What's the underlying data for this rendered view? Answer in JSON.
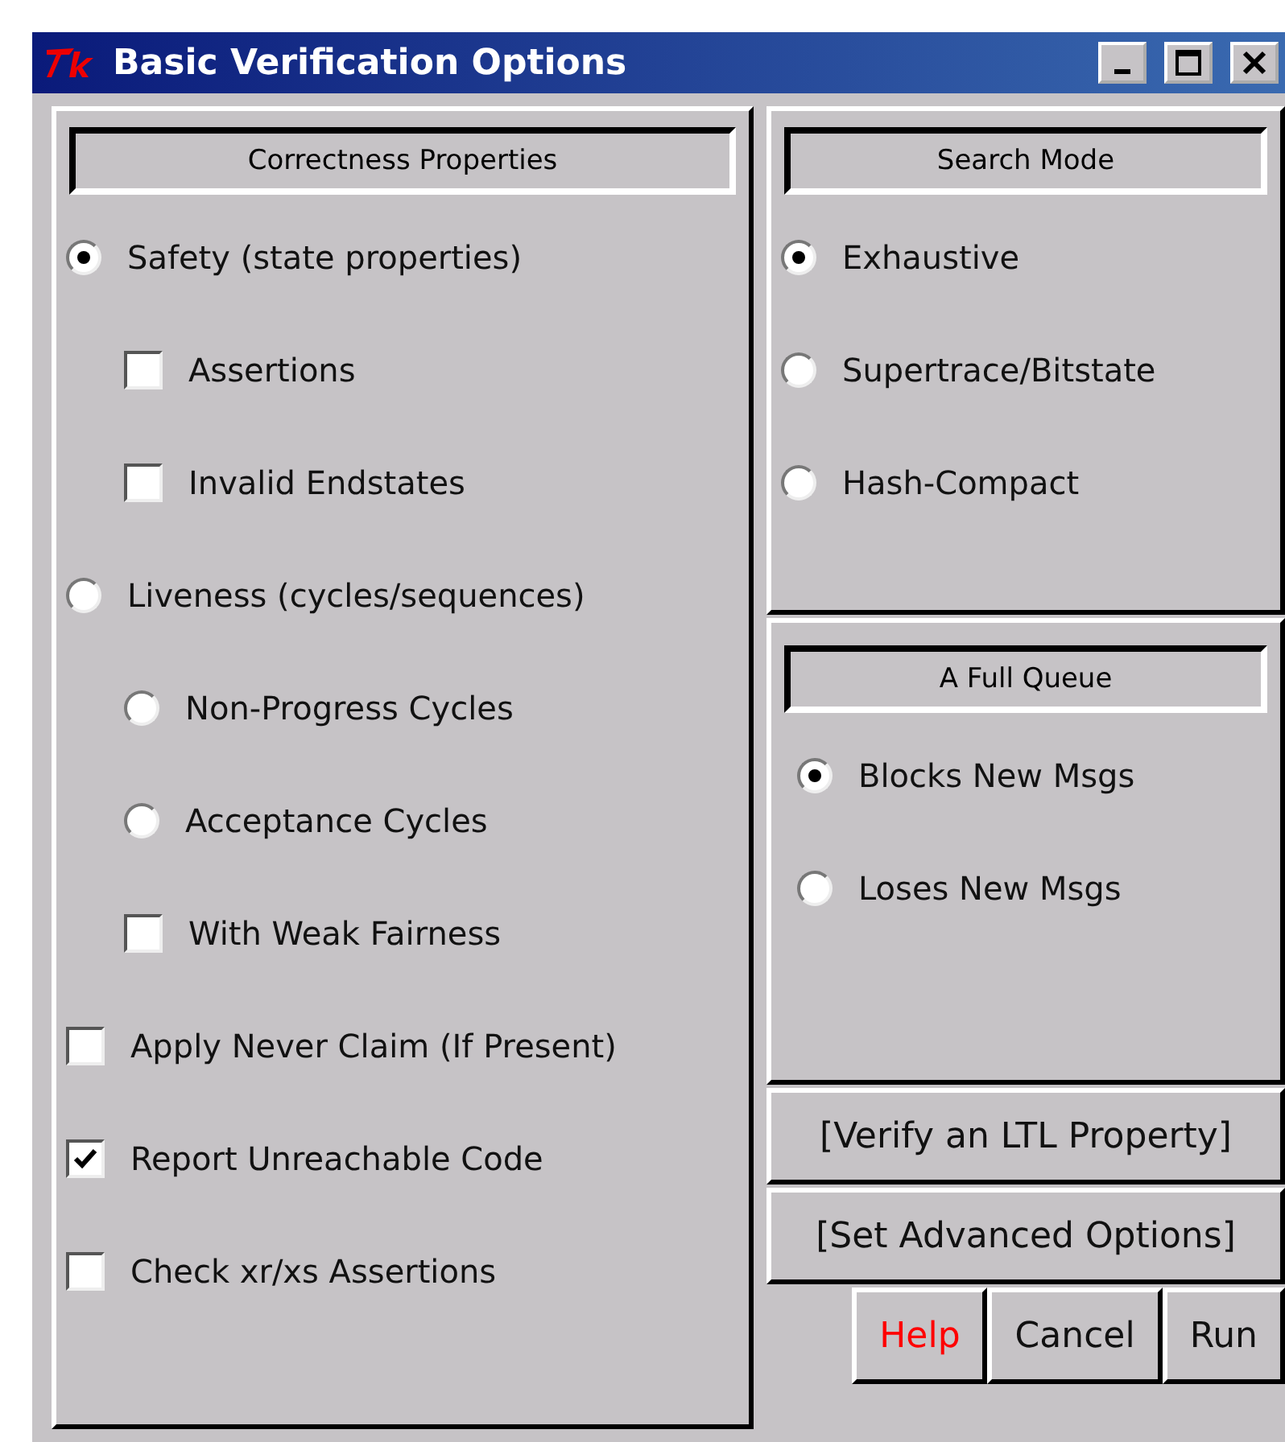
{
  "window": {
    "title": "Basic Verification Options"
  },
  "correctness": {
    "heading": "Correctness Properties",
    "options": [
      {
        "kind": "radio",
        "label": "Safety (state properties)",
        "selected": true,
        "children": [
          {
            "kind": "checkbox",
            "label": "Assertions",
            "checked": false
          },
          {
            "kind": "checkbox",
            "label": "Invalid Endstates",
            "checked": false
          }
        ]
      },
      {
        "kind": "radio",
        "label": "Liveness (cycles/sequences)",
        "selected": false,
        "children": [
          {
            "kind": "radio",
            "label": "Non-Progress Cycles",
            "selected": false
          },
          {
            "kind": "radio",
            "label": "Acceptance Cycles",
            "selected": false
          },
          {
            "kind": "checkbox",
            "label": "With Weak Fairness",
            "checked": false
          }
        ]
      },
      {
        "kind": "checkbox",
        "label": "Apply Never Claim (If Present)",
        "checked": false
      },
      {
        "kind": "checkbox",
        "label": "Report Unreachable Code",
        "checked": true
      },
      {
        "kind": "checkbox",
        "label": "Check xr/xs Assertions",
        "checked": false
      }
    ]
  },
  "search_mode": {
    "heading": "Search Mode",
    "options": [
      {
        "label": "Exhaustive",
        "selected": true
      },
      {
        "label": "Supertrace/Bitstate",
        "selected": false
      },
      {
        "label": "Hash-Compact",
        "selected": false
      }
    ]
  },
  "full_queue": {
    "heading": "A Full Queue",
    "options": [
      {
        "label": "Blocks New Msgs",
        "selected": true
      },
      {
        "label": "Loses New Msgs",
        "selected": false
      }
    ]
  },
  "wide_buttons": [
    "[Verify an LTL Property]",
    "[Set Advanced Options]"
  ],
  "buttons": [
    {
      "label": "Help",
      "kind": "help"
    },
    {
      "label": "Cancel",
      "kind": "normal"
    },
    {
      "label": "Run",
      "kind": "normal"
    }
  ]
}
